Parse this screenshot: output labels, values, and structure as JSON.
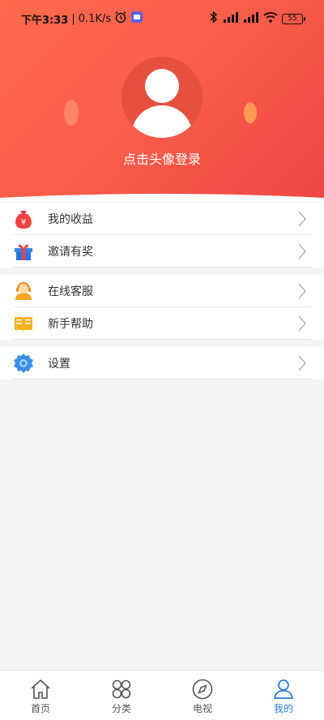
{
  "status_bar": {
    "time": "下午3:33",
    "separator": "|",
    "speed": "0.1K/s",
    "battery": "55"
  },
  "profile": {
    "login_prompt": "点击头像登录"
  },
  "menu_groups": [
    {
      "items": [
        {
          "label": "我的收益",
          "icon": "money-bag-icon"
        },
        {
          "label": "邀请有奖",
          "icon": "gift-icon"
        }
      ]
    },
    {
      "items": [
        {
          "label": "在线客服",
          "icon": "customer-service-icon"
        },
        {
          "label": "新手帮助",
          "icon": "help-book-icon"
        }
      ]
    },
    {
      "items": [
        {
          "label": "设置",
          "icon": "settings-gear-icon"
        }
      ]
    }
  ],
  "bottom_nav": {
    "items": [
      {
        "label": "首页",
        "icon": "home-icon"
      },
      {
        "label": "分类",
        "icon": "category-icon"
      },
      {
        "label": "电视",
        "icon": "compass-icon"
      },
      {
        "label": "我的",
        "icon": "user-icon"
      }
    ],
    "active_index": 3
  },
  "colors": {
    "header_start": "#ff6a4d",
    "header_end": "#ef4645",
    "nav_active": "#2f7fd6"
  }
}
